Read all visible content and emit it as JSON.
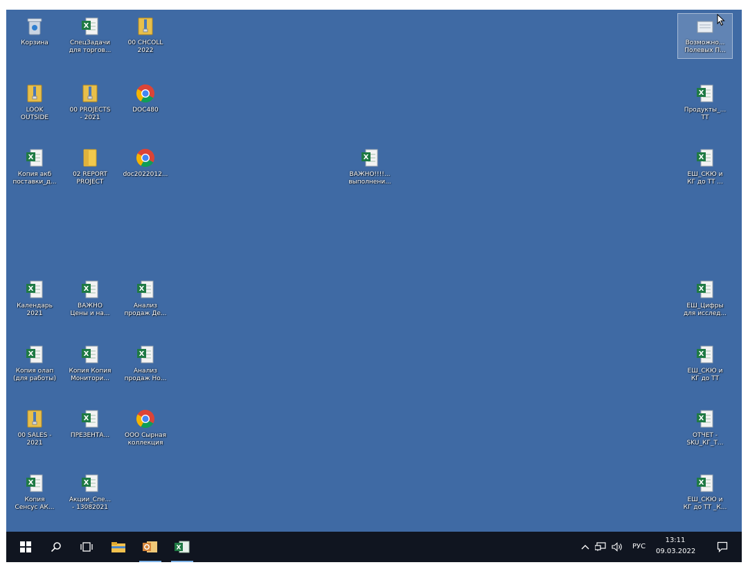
{
  "desktop": {
    "icons": [
      {
        "label": "Корзина",
        "type": "recycle-bin"
      },
      {
        "label": "СпецЗадачи\nдля торгов...",
        "type": "excel"
      },
      {
        "label": "00 CHCOLL\n2022",
        "type": "folder-zip"
      },
      {
        "label": "LOOK\nOUTSIDE",
        "type": "folder-zip"
      },
      {
        "label": "00 PROJECTS\n- 2021",
        "type": "folder-zip"
      },
      {
        "label": "DOC480",
        "type": "chrome"
      },
      {
        "label": "Копия акб\nпоставки_д...",
        "type": "excel"
      },
      {
        "label": "02 REPORT\nPROJECT",
        "type": "folder"
      },
      {
        "label": "doc2022012...",
        "type": "chrome"
      },
      {
        "label": "ВАЖНО!!!!...\nвыполнени...",
        "type": "excel"
      },
      {
        "label": "Календарь\n2021",
        "type": "excel"
      },
      {
        "label": "ВАЖНО\nЦены и на...",
        "type": "excel"
      },
      {
        "label": "Анализ\nпродаж Де...",
        "type": "excel"
      },
      {
        "label": "Копия олап\n(для работы)",
        "type": "excel"
      },
      {
        "label": "Копия Копия\nМонитори...",
        "type": "excel"
      },
      {
        "label": "Анализ\nпродаж Но...",
        "type": "excel"
      },
      {
        "label": "00 SALES -\n2021",
        "type": "folder-zip"
      },
      {
        "label": "ПРЕЗЕНТА...",
        "type": "excel"
      },
      {
        "label": "ООО Сырная\nколлекция",
        "type": "chrome"
      },
      {
        "label": "Копия\nСенсус АК...",
        "type": "excel"
      },
      {
        "label": "Акции_Спе...\n- 13082021",
        "type": "excel"
      },
      {
        "label": "Возможно...\nПолевых П...",
        "type": "generic-file"
      },
      {
        "label": "Продукты_...\nТТ",
        "type": "excel"
      },
      {
        "label": "ЕШ_СКЮ и\nКГ до ТТ ...",
        "type": "excel"
      },
      {
        "label": "ЕШ_Цифры\nдля исслед...",
        "type": "excel"
      },
      {
        "label": "ЕШ_СКЮ и\nКГ до ТТ",
        "type": "excel"
      },
      {
        "label": "ОТЧЕТ -\nSKU_КГ_Т...",
        "type": "excel"
      },
      {
        "label": "ЕШ_СКЮ и\nКГ до ТТ _К...",
        "type": "excel"
      }
    ]
  },
  "taskbar": {
    "lang": "РУС",
    "time": "13:11",
    "date": "09.03.2022"
  },
  "colors": {
    "desktop": "#3f6aa4",
    "taskbar": "#101520",
    "excel_green": "#1f7a44",
    "folder_yellow": "#e8bf4a",
    "outlook_orange": "#d4843a",
    "active_indicator": "#7eb4ea"
  }
}
